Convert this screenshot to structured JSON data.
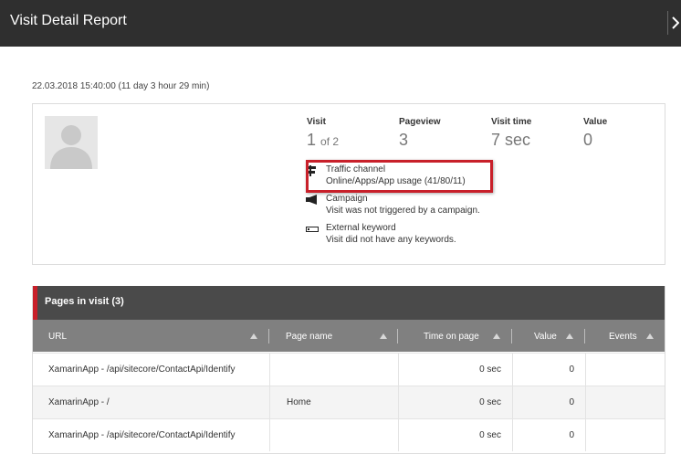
{
  "window": {
    "title": "Visit Detail Report"
  },
  "visit_datetime": "22.03.2018 15:40:00 (11 day 3 hour 29 min)",
  "stats": {
    "visit": {
      "label": "Visit",
      "value": "1",
      "of": "of 2"
    },
    "pageview": {
      "label": "Pageview",
      "value": "3"
    },
    "visit_time": {
      "label": "Visit time",
      "value": "7 sec"
    },
    "value": {
      "label": "Value",
      "value": "0"
    }
  },
  "info": {
    "traffic_channel": {
      "title": "Traffic channel",
      "detail": "Online/Apps/App usage (41/80/11)"
    },
    "campaign": {
      "title": "Campaign",
      "detail": "Visit was not triggered by a campaign."
    },
    "external_keyword": {
      "title": "External keyword",
      "detail": "Visit did not have any keywords."
    }
  },
  "pages": {
    "title": "Pages in visit (3)",
    "columns": [
      "URL",
      "Page name",
      "Time on page",
      "Value",
      "Events"
    ],
    "rows": [
      [
        "XamarinApp - /api/sitecore/ContactApi/Identify",
        "",
        "0 sec",
        "0",
        ""
      ],
      [
        "XamarinApp - /",
        "Home",
        "0 sec",
        "0",
        ""
      ],
      [
        "XamarinApp - /api/sitecore/ContactApi/Identify",
        "",
        "0 sec",
        "0",
        ""
      ]
    ]
  },
  "colors": {
    "header_bg": "#2f2f2f",
    "accent_red": "#c8202a",
    "table_header": "#808080",
    "section_header": "#4a4a4a"
  }
}
